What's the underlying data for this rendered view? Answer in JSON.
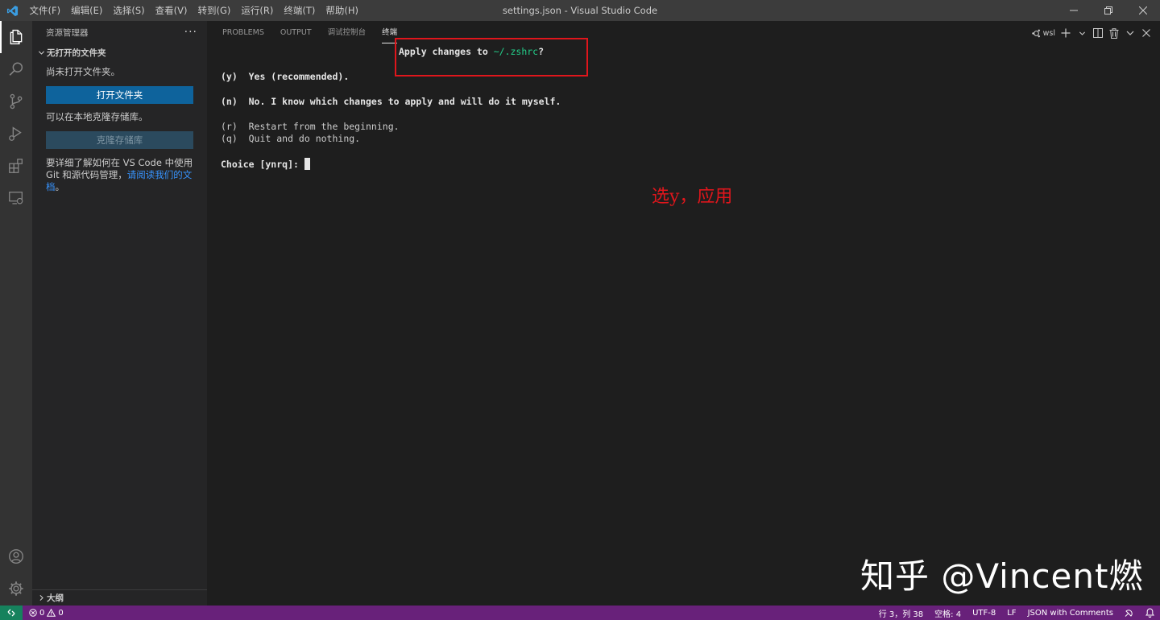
{
  "titlebar": {
    "menu": [
      "文件(F)",
      "编辑(E)",
      "选择(S)",
      "查看(V)",
      "转到(G)",
      "运行(R)",
      "终端(T)",
      "帮助(H)"
    ],
    "window_title": "settings.json - Visual Studio Code"
  },
  "activitybar": {
    "icons": [
      "files-icon",
      "search-icon",
      "source-control-icon",
      "run-debug-icon",
      "extensions-icon",
      "remote-explorer-icon",
      "account-icon",
      "settings-gear-icon"
    ]
  },
  "sidebar": {
    "title": "资源管理器",
    "more": "···",
    "section_title": "无打开的文件夹",
    "no_folder_text": "尚未打开文件夹。",
    "open_folder_button": "打开文件夹",
    "clone_text": "可以在本地克隆存储库。",
    "clone_button": "克隆存储库",
    "help_line1": "要详细了解如何在 VS Code 中使用",
    "help_line2_prefix": "Git 和源代码管理，",
    "help_link_part1": "请阅读我们的文",
    "help_link_part2": "档",
    "help_suffix": "。",
    "outline_title": "大纲"
  },
  "panel": {
    "tabs": [
      "PROBLEMS",
      "OUTPUT",
      "调试控制台",
      "终端"
    ],
    "active_tab": 3,
    "terminal_name": "wsl"
  },
  "terminal": {
    "prompt_prefix": "Apply changes to ",
    "prompt_path": "~/.zshrc",
    "prompt_suffix": "?",
    "option_y": "(y)  Yes (recommended).",
    "option_n": "(n)  No. I know which changes to apply and will do it myself.",
    "option_r": "(r)  Restart from the beginning.",
    "option_q": "(q)  Quit and do nothing.",
    "choice_prompt": "Choice [ynrq]: "
  },
  "annotation": {
    "text": "选y，应用",
    "color": "#e0161c"
  },
  "watermark": "知乎 @Vincent燃",
  "statusbar": {
    "errors": "0",
    "warnings": "0",
    "cursor_position": "行 3，列 38",
    "indent": "空格: 4",
    "encoding": "UTF-8",
    "eol": "LF",
    "language": "JSON with Comments",
    "bg_color": "#68217a"
  }
}
